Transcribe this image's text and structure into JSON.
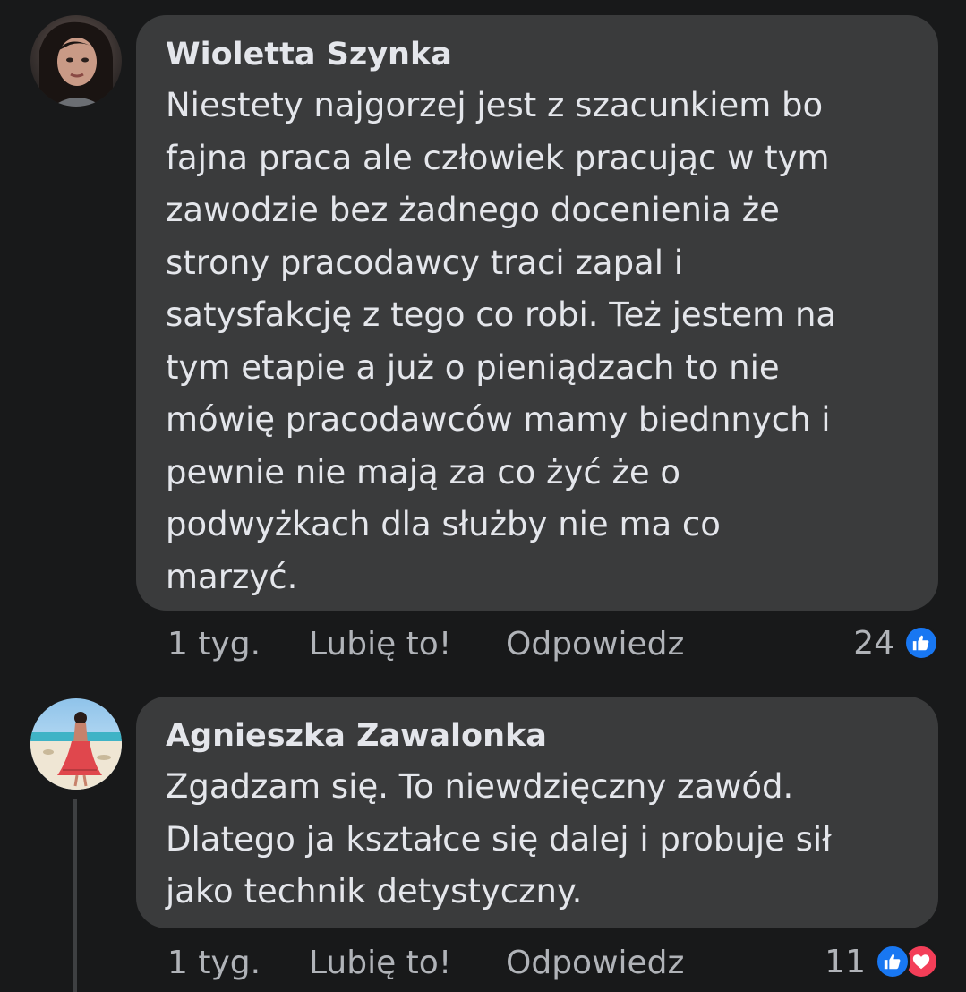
{
  "comments": [
    {
      "author": "Wioletta Szynka",
      "lines": [
        "Niestety  najgorzej jest z szacunkiem bo",
        "fajna praca ale człowiek pracując w tym",
        "zawodzie bez żadnego docenienia że",
        "strony pracodawcy traci zapal i",
        "satysfakcję z tego co robi. Też jestem na",
        "tym etapie a już o pieniądzach to nie",
        "mówię pracodawców mamy biednnych i",
        "pewnie nie mają za co żyć że o",
        "podwyżkach dla służby nie ma co",
        "marzyć."
      ],
      "time": "1 tyg.",
      "like_label": "Lubię to!",
      "reply_label": "Odpowiedz",
      "reaction_count": "24",
      "reactions": [
        "like-icon"
      ]
    },
    {
      "author": "Agnieszka Zawalonka",
      "lines": [
        "Zgadzam się.  To niewdzięczny zawód.",
        "Dlatego ja kształce się dalej i probuje sił",
        "jako technik detystyczny."
      ],
      "time": "1 tyg.",
      "like_label": "Lubię to!",
      "reply_label": "Odpowiedz",
      "reaction_count": "11",
      "reactions": [
        "like-icon",
        "love-icon"
      ]
    }
  ],
  "colors": {
    "background": "#18191a",
    "bubble": "#3a3b3c",
    "primary_text": "#e4e6eb",
    "secondary_text": "#b0b3b8",
    "like_blue": "#1877f2",
    "love_red": "#f33e58"
  }
}
